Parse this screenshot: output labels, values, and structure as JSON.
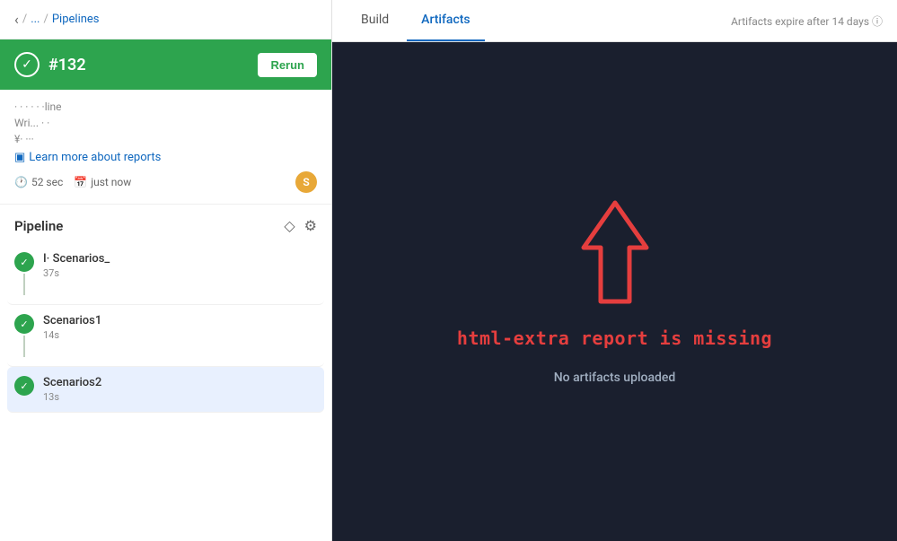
{
  "breadcrumb": {
    "back_label": "‹",
    "ellipsis": "...",
    "separator": "/",
    "pipeline_label": "Pipelines"
  },
  "pipeline_header": {
    "number": "#132",
    "rerun_label": "Rerun"
  },
  "info_card": {
    "row1_text": "· · ·   · ·  ·line",
    "row2_text": "Wri...   · ·",
    "row3_text": "¥·  ···",
    "learn_more_label": "Learn more about reports",
    "duration": "52 sec",
    "time": "just now",
    "avatar_label": "S"
  },
  "pipeline_section": {
    "title": "Pipeline",
    "stages": [
      {
        "name": "I· Scenarios_",
        "time": "37s",
        "active": false
      },
      {
        "name": "Scenarios1",
        "time": "14s",
        "active": false
      },
      {
        "name": "Scenarios2",
        "time": "13s",
        "active": true
      }
    ]
  },
  "tabs": {
    "build_label": "Build",
    "artifacts_label": "Artifacts",
    "expire_notice": "Artifacts expire after 14 days  ⓘ"
  },
  "artifacts_panel": {
    "missing_text": "html-extra report is missing",
    "no_artifacts_text": "No artifacts uploaded"
  }
}
